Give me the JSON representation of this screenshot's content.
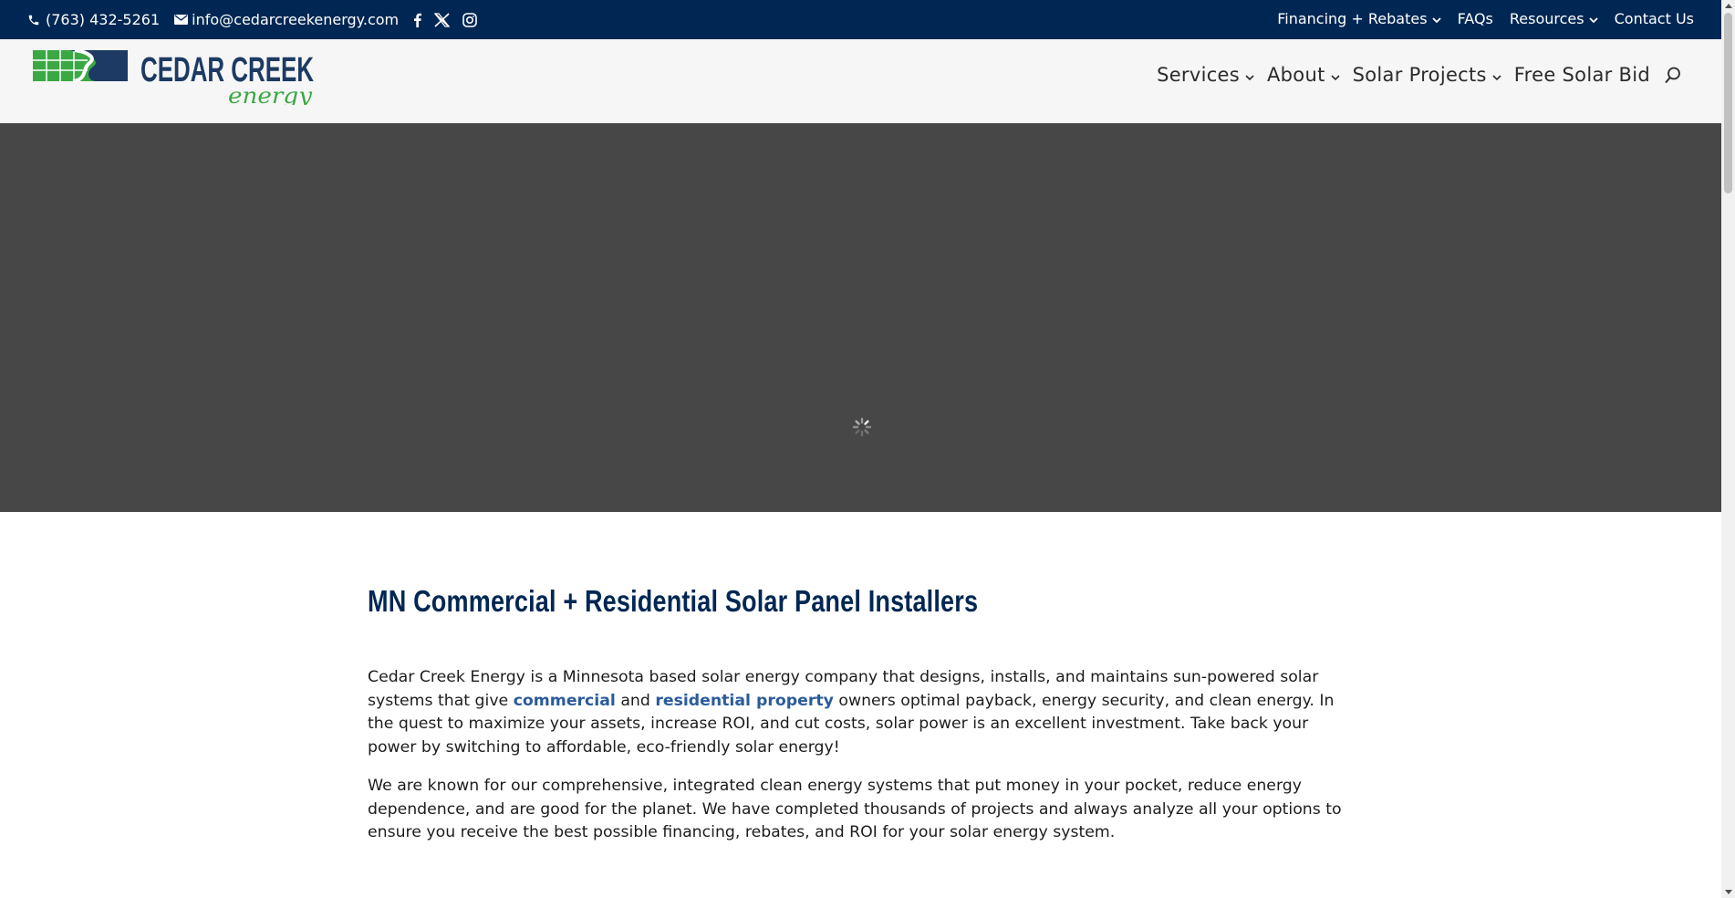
{
  "topbar": {
    "phone": "(763) 432-5261",
    "email": "info@cedarcreekenergy.com",
    "social_icons": [
      "facebook-icon",
      "x-twitter-icon",
      "instagram-icon"
    ],
    "nav": [
      {
        "label": "Financing + Rebates",
        "has_dropdown": true
      },
      {
        "label": "FAQs",
        "has_dropdown": false
      },
      {
        "label": "Resources",
        "has_dropdown": true
      },
      {
        "label": "Contact Us",
        "has_dropdown": false
      }
    ]
  },
  "header": {
    "logo": {
      "line1": "CEDAR CREEK",
      "line2": "energy"
    },
    "nav": [
      {
        "label": "Services",
        "has_dropdown": true
      },
      {
        "label": "About",
        "has_dropdown": true
      },
      {
        "label": "Solar Projects",
        "has_dropdown": true
      },
      {
        "label": "Free Solar Bid",
        "has_dropdown": false
      }
    ],
    "search_icon": "search-icon"
  },
  "hero": {
    "state": "loading"
  },
  "content": {
    "heading": "MN Commercial + Residential Solar Panel Installers",
    "p1_before": "Cedar Creek Energy is a Minnesota based solar energy company that designs, installs, and maintains sun-powered solar systems that give ",
    "p1_link1": "commercial",
    "p1_mid": " and ",
    "p1_link2": "residential property",
    "p1_after": " owners optimal payback, energy security, and clean energy. In the quest to maximize your assets, increase ROI, and cut costs, solar power is an excellent investment. Take back your power by switching to affordable, eco-friendly solar energy!",
    "p2": "We are known for our comprehensive, integrated clean energy systems that put money in your pocket, reduce energy dependence, and are good for the planet. We have completed thousands of projects and always analyze all your options to ensure you receive the best possible financing, rebates, and ROI for your solar energy system."
  },
  "colors": {
    "topbar_bg": "#002753",
    "header_bg": "#f6f6f6",
    "hero_bg": "#474747",
    "heading": "#002753",
    "link": "#2a5b9c",
    "logo_green": "#3aa843",
    "logo_navy": "#1c3a63"
  }
}
